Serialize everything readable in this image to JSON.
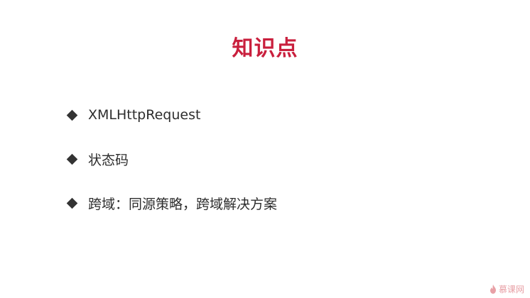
{
  "slide": {
    "title": "知识点",
    "accent_color": "#c91f3d",
    "bullet_icon": "diamond-icon",
    "items": [
      {
        "label": "XMLHttpRequest"
      },
      {
        "label": "状态码"
      },
      {
        "label": "跨域：同源策略，跨域解决方案"
      }
    ]
  },
  "watermark": {
    "icon": "flame-icon",
    "label": "慕课网"
  }
}
